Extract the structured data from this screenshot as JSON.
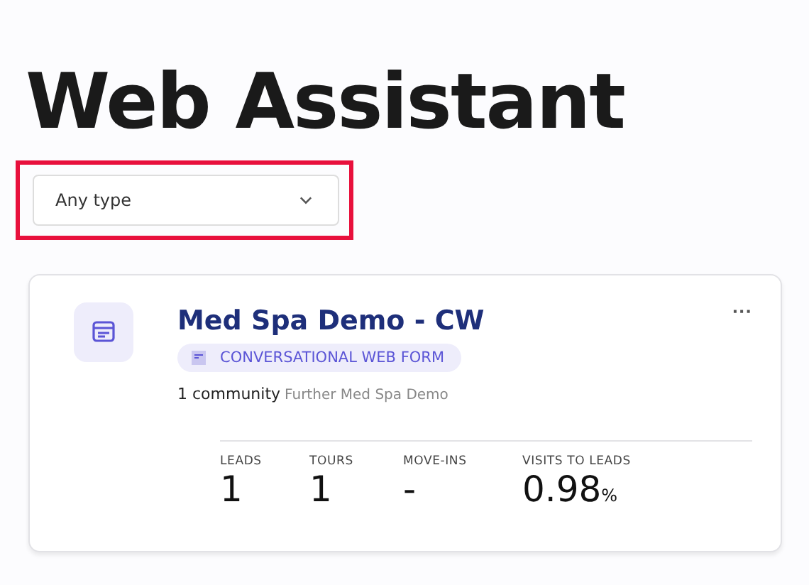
{
  "title": "Web Assistant",
  "filter": {
    "value": "Any type",
    "highlighted": true
  },
  "card": {
    "name": "Med Spa Demo - CW",
    "type_badge": "CONVERSATIONAL WEB FORM",
    "menu": "···",
    "community_count": "1 community",
    "community_name": "Further Med Spa Demo",
    "stats": [
      {
        "label": "LEADS",
        "value": "1"
      },
      {
        "label": "TOURS",
        "value": "1"
      },
      {
        "label": "MOVE-INS",
        "value": "-"
      },
      {
        "label": "VISITS TO LEADS",
        "value": "0.98",
        "unit": "%"
      }
    ]
  }
}
